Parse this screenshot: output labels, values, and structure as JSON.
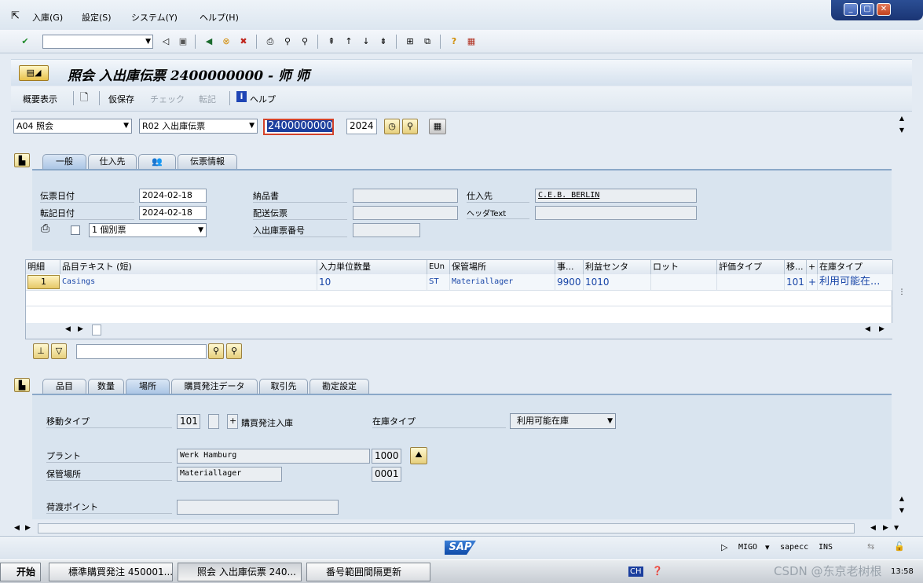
{
  "menu": [
    "入庫(G)",
    "設定(S)",
    "システム(Y)",
    "ヘルプ(H)"
  ],
  "window_controls": [
    "minimize",
    "restore",
    "close"
  ],
  "toolbar": {
    "command_value": ""
  },
  "title": "照会 入出庫伝票 2400000000 - 师 师",
  "app_toolbar": {
    "summary": "概要表示",
    "hold": "仮保存",
    "check": "チェック",
    "post": "転記",
    "help": "ヘルプ"
  },
  "header_row": {
    "action": "A04 照会",
    "doc_type": "R02 入出庫伝票",
    "doc_number": "2400000000",
    "year": "2024"
  },
  "tabs_top": [
    "一般",
    "仕入先",
    "",
    "伝票情報"
  ],
  "general": {
    "doc_date_label": "伝票日付",
    "doc_date": "2024-02-18",
    "post_date_label": "転記日付",
    "post_date": "2024-02-18",
    "print_option": "1 個別票",
    "delivery_note_label": "納品書",
    "delivery_note": "",
    "bill_of_lading_label": "配送伝票",
    "bill_of_lading": "",
    "gr_slip_label": "入出庫票番号",
    "gr_slip": "",
    "vendor_label": "仕入先",
    "vendor": "C.E.B. BERLIN",
    "header_text_label": "ヘッダText",
    "header_text": ""
  },
  "grid": {
    "headers": [
      "明細",
      "品目テキスト (短)",
      "入力単位数量",
      "EUn",
      "保管場所",
      "事...",
      "利益センタ",
      "ロット",
      "評価タイプ",
      "移...",
      "+",
      "在庫タイプ"
    ],
    "rows": [
      {
        "item": "1",
        "text": "Casings",
        "qty": "10",
        "unit": "ST",
        "sloc": "Materiallager",
        "bus": "9900",
        "profit": "1010",
        "batch": "",
        "val": "",
        "mvt": "101",
        "plus": "+",
        "stock": "利用可能在..."
      }
    ]
  },
  "tabs_bottom": [
    "品目",
    "数量",
    "場所",
    "購買発注データ",
    "取引先",
    "勘定設定"
  ],
  "where": {
    "mvt_label": "移動タイプ",
    "mvt": "101",
    "mvt_ind": "",
    "plus": "+",
    "mvt_text": "購買発注入庫",
    "stock_type_label": "在庫タイプ",
    "stock_type": "利用可能在庫",
    "plant_label": "プラント",
    "plant_name": "Werk Hamburg",
    "plant": "1000",
    "sloc_label": "保管場所",
    "sloc_name": "Materiallager",
    "sloc": "0001",
    "unloading_label": "荷渡ポイント",
    "unloading": ""
  },
  "status": {
    "tcode": "MIGO",
    "system": "sapecc",
    "mode": "INS"
  },
  "taskbar": {
    "start": "开始",
    "tasks": [
      "標準購買発注 450001...",
      "照会 入出庫伝票 240...",
      "番号範囲間隔更新"
    ],
    "lang": "CH",
    "time": "13:58",
    "watermark": "CSDN @东京老树根"
  }
}
